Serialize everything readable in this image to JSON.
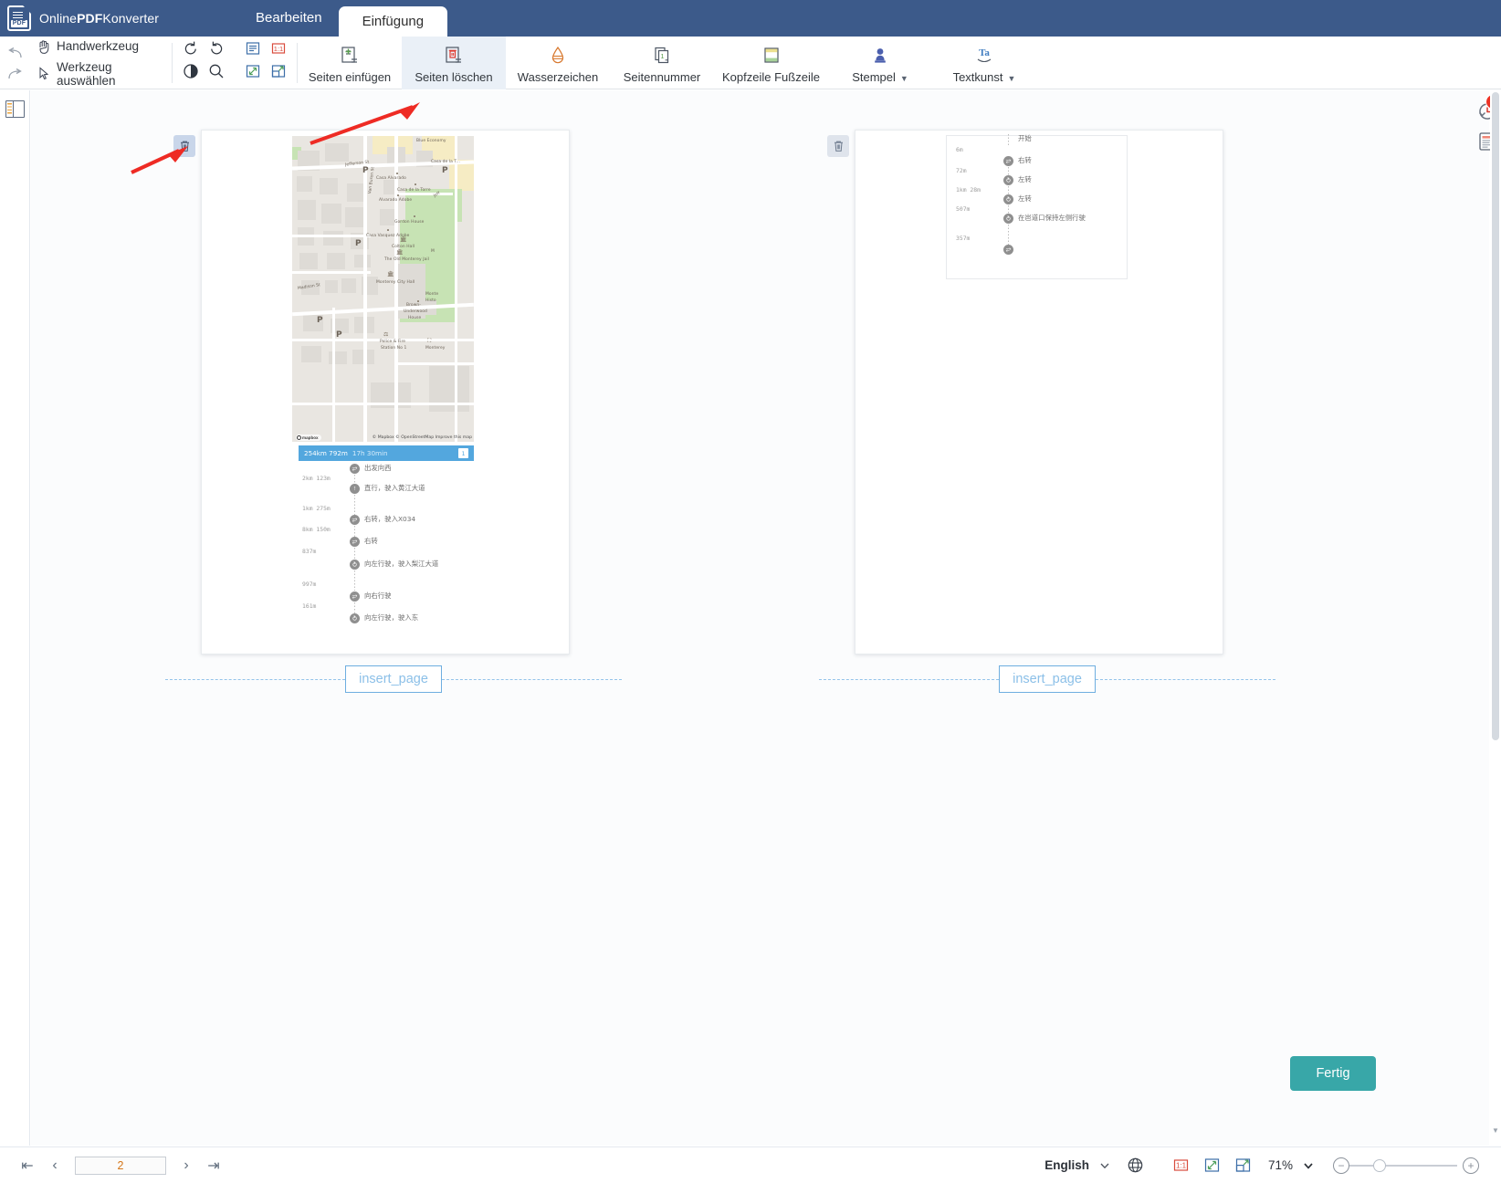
{
  "app": {
    "brand_prefix": "Online",
    "brand_bold": "PDF",
    "brand_suffix": "Konverter",
    "logo_label": "PDF"
  },
  "tabs": [
    {
      "label": "Bearbeiten",
      "active": false
    },
    {
      "label": "Einfügung",
      "active": true
    }
  ],
  "ribbon": {
    "hand_tool": "Handwerkzeug",
    "select_tool": "Werkzeug auswählen",
    "icons": {
      "undo": "undo-arrow-icon",
      "redo": "redo-arrow-icon",
      "rotate_left": "rotate-left-icon",
      "rotate_right": "rotate-right-icon",
      "fit_page": "fit-page-icon",
      "actual_size": "actual-size-1to1-icon",
      "contrast": "contrast-icon",
      "search": "search-icon",
      "fullscreen": "expand-icon",
      "fit_width": "fit-width-icon"
    },
    "buttons": [
      {
        "label": "Seiten einfügen",
        "icon": "insert-pages-icon",
        "active": false,
        "caret": false
      },
      {
        "label": "Seiten löschen",
        "icon": "delete-pages-icon",
        "active": true,
        "caret": false
      },
      {
        "label": "Wasserzeichen",
        "icon": "watermark-icon",
        "active": false,
        "caret": false
      },
      {
        "label": "Seitennummer",
        "icon": "page-number-icon",
        "active": false,
        "caret": false
      },
      {
        "label": "Kopfzeile Fußzeile",
        "icon": "header-footer-icon",
        "active": false,
        "caret": false
      },
      {
        "label": "Stempel",
        "icon": "stamp-icon",
        "active": false,
        "caret": true
      },
      {
        "label": "Textkunst",
        "icon": "text-art-icon",
        "active": false,
        "caret": true
      }
    ]
  },
  "workspace": {
    "insert_page_label": "insert_page",
    "delete_icon": "trash-icon",
    "pages": [
      {
        "index": 1,
        "has_map": true,
        "map": {
          "streets": [
            "Jefferson St",
            "Van Buren St",
            "Madison St"
          ],
          "places": [
            "Blue Economy",
            "Casa de la T...",
            "Casa Alvarado",
            "Casa de la Torre",
            "Alvarado Adobe",
            "Gordon House",
            "Casa Vasquez Adobe",
            "Colton Hall",
            "The Old Monterey Jail",
            "Monterey City Hall",
            "Brown-Underwood House",
            "Police & Fire Station No 1",
            "Monterey",
            "Monte Histo"
          ],
          "parking_marks": [
            "P",
            "P",
            "P",
            "P",
            "P"
          ],
          "attribution": "© Mapbox © OpenStreetMap Improve this map",
          "logo": "mapbox"
        },
        "route": {
          "distance": "254km 792m",
          "duration": "17h 30min",
          "page_badge": "1",
          "steps": [
            {
              "dist": "",
              "text": "出发向西",
              "icon": "turn-right-round-icon"
            },
            {
              "dist": "2km 123m",
              "text": "直行，驶入黄江大道",
              "icon": "straight-icon"
            },
            {
              "dist": "1km 275m",
              "text": "右转，驶入X034",
              "icon": "turn-right-round-icon"
            },
            {
              "dist": "8km 150m",
              "text": "右转",
              "icon": "turn-right-round-icon"
            },
            {
              "dist": "837m",
              "text": "向左行驶，驶入梨江大道",
              "icon": "turn-left-round-icon"
            },
            {
              "dist": "997m",
              "text": "向右行驶",
              "icon": "turn-right-round-icon"
            },
            {
              "dist": "161m",
              "text": "向左行驶，驶入东",
              "icon": "turn-left-round-icon"
            }
          ]
        }
      },
      {
        "index": 2,
        "has_map": false,
        "route": {
          "steps": [
            {
              "dist": "",
              "text": "开始",
              "icon": "start-icon"
            },
            {
              "dist": "6m",
              "text": "右转",
              "icon": "turn-right-round-icon"
            },
            {
              "dist": "72m",
              "text": "左转",
              "icon": "turn-left-round-icon"
            },
            {
              "dist": "1km 28m",
              "text": "左转",
              "icon": "turn-left-round-icon"
            },
            {
              "dist": "507m",
              "text": "在岜道口保持左侧行驶",
              "icon": "keep-left-icon"
            },
            {
              "dist": "357m",
              "text": "",
              "icon": "turn-right-round-icon"
            }
          ]
        }
      }
    ]
  },
  "right_rail": {
    "comment_count": "0",
    "buttons": [
      {
        "name": "comment-history-icon"
      },
      {
        "name": "document-properties-icon"
      }
    ]
  },
  "actions": {
    "done_label": "Fertig"
  },
  "statusbar": {
    "first_page_icon": "first-page-icon",
    "prev_page_icon": "prev-page-icon",
    "current_page": "2",
    "next_page_icon": "next-page-icon",
    "last_page_icon": "last-page-icon",
    "language": "English",
    "language_caret": "chevron-down-icon",
    "globe_icon": "globe-icon",
    "actual_size_icon": "actual-size-1to1-icon",
    "fit_page_icon": "fit-page-icon",
    "fit_width_icon": "fit-width-icon",
    "zoom_level": "71%",
    "zoom_caret": "chevron-down-icon",
    "zoom_out": "minus-icon",
    "zoom_in": "plus-icon"
  },
  "colors": {
    "titlebar": "#3c5a8a",
    "accent_done": "#38a7a8",
    "insert_blue": "#8cc0e8",
    "badge_red": "#ee3124",
    "route_header": "#53a7de",
    "annotation_arrow": "#ee2b24"
  }
}
